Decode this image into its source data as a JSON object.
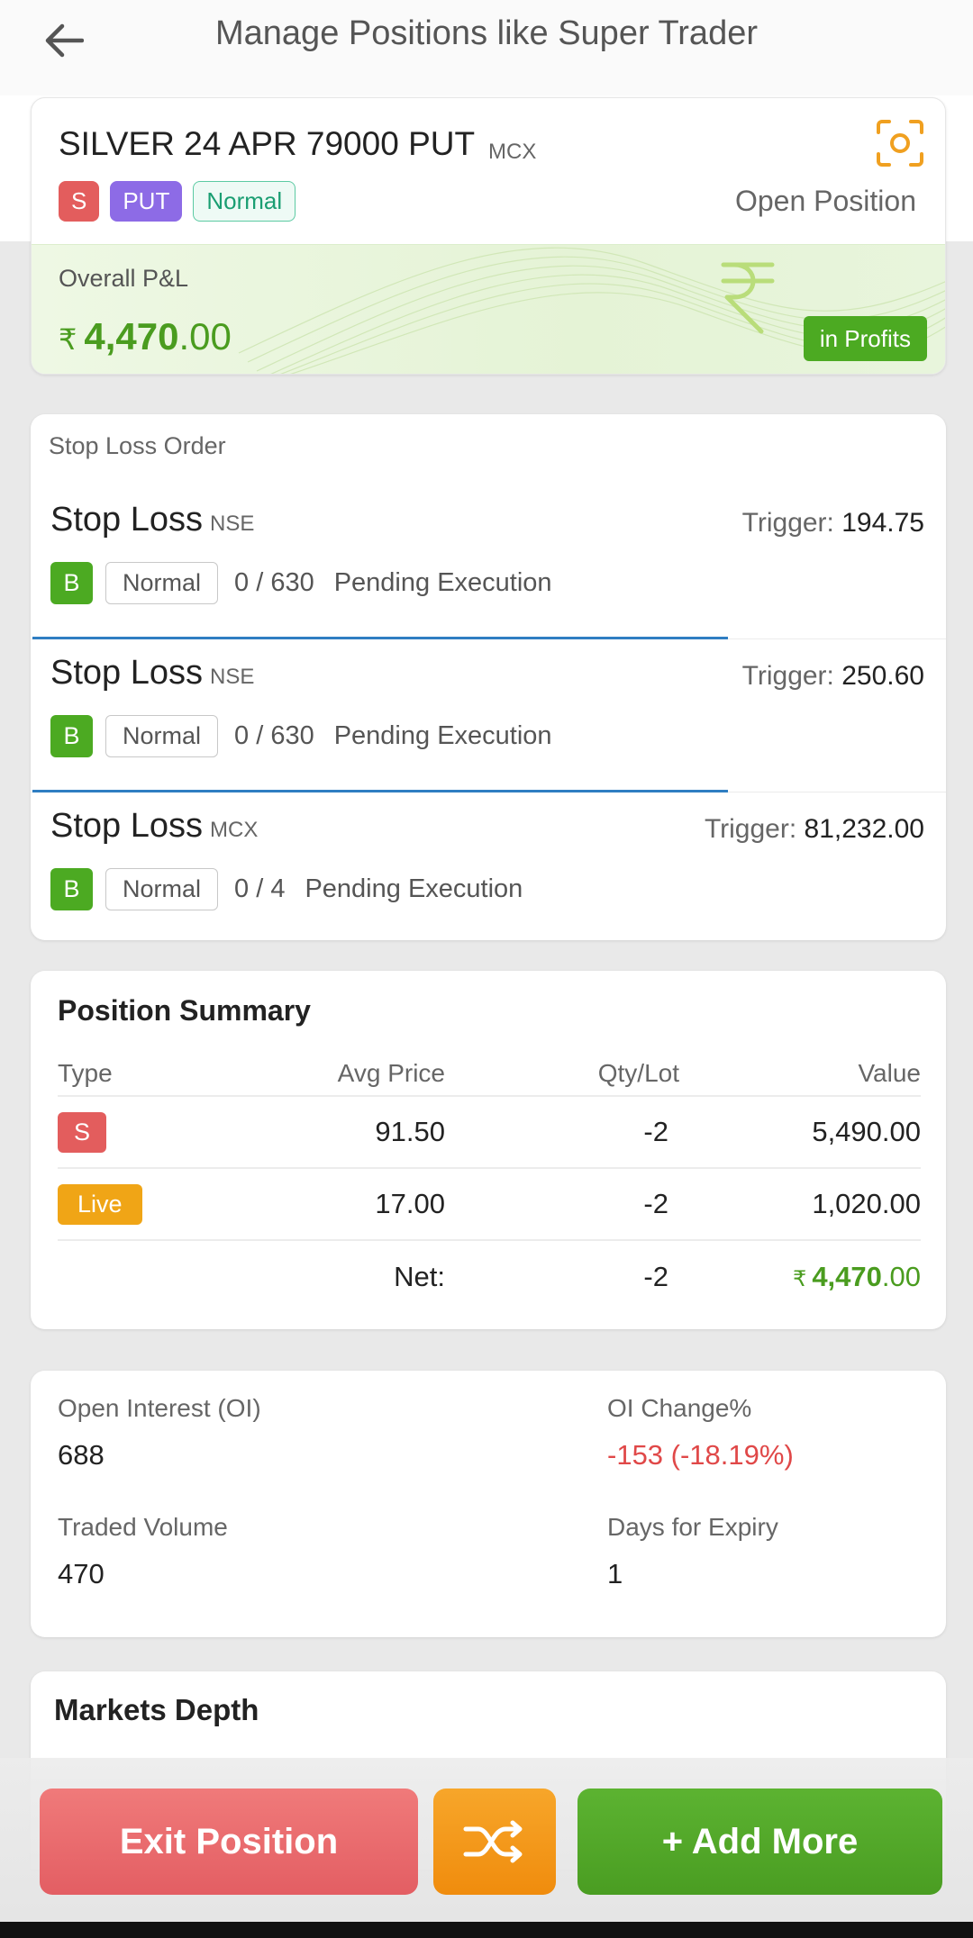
{
  "header": {
    "title": "Manage Positions like Super Trader"
  },
  "instrument": {
    "name": "SILVER 24 APR 79000 PUT",
    "exchange": "MCX",
    "tags": {
      "side": "S",
      "option_type": "PUT",
      "order_type": "Normal"
    },
    "status": "Open Position",
    "pnl": {
      "label": "Overall P&L",
      "currency": "₹",
      "value_int": "4,470",
      "value_dec": ".00",
      "badge": "in Profits"
    }
  },
  "stop_loss": {
    "section_title": "Stop Loss Order",
    "orders": [
      {
        "title": "Stop Loss",
        "exchange": "NSE",
        "trigger_label": "Trigger:",
        "trigger": "194.75",
        "side": "B",
        "type": "Normal",
        "qty": "0 / 630",
        "status": "Pending Execution",
        "progress": 0.76
      },
      {
        "title": "Stop Loss",
        "exchange": "NSE",
        "trigger_label": "Trigger:",
        "trigger": "250.60",
        "side": "B",
        "type": "Normal",
        "qty": "0 / 630",
        "status": "Pending Execution",
        "progress": 0.76
      },
      {
        "title": "Stop Loss",
        "exchange": "MCX",
        "trigger_label": "Trigger:",
        "trigger": "81,232.00",
        "side": "B",
        "type": "Normal",
        "qty": "0 / 4",
        "status": "Pending Execution",
        "progress": 0
      }
    ]
  },
  "position_summary": {
    "title": "Position Summary",
    "columns": [
      "Type",
      "Avg Price",
      "Qty/Lot",
      "Value"
    ],
    "rows": [
      {
        "type": "S",
        "avg_price": "91.50",
        "qty": "-2",
        "value": "5,490.00"
      },
      {
        "type": "Live",
        "avg_price": "17.00",
        "qty": "-2",
        "value": "1,020.00"
      }
    ],
    "net": {
      "label": "Net:",
      "qty": "-2",
      "currency": "₹",
      "value_int": "4,470",
      "value_dec": ".00"
    }
  },
  "stats": {
    "open_interest": {
      "label": "Open Interest (OI)",
      "value": "688"
    },
    "oi_change": {
      "label": "OI Change%",
      "value": "-153 (-18.19%)"
    },
    "traded_volume": {
      "label": "Traded Volume",
      "value": "470"
    },
    "days_for_expiry": {
      "label": "Days for Expiry",
      "value": "1"
    }
  },
  "market_depth": {
    "title": "Markets Depth"
  },
  "actions": {
    "exit": "Exit Position",
    "shuffle_icon": "shuffle-icon",
    "add": "+ Add More"
  },
  "colors": {
    "profit_green": "#4a9c1f",
    "loss_red": "#e04848",
    "sell_red": "#e35d5d",
    "buy_green": "#4caa22",
    "put_purple": "#8d6be6",
    "live_orange": "#f0a516",
    "progress_blue": "#2f7ec2"
  }
}
